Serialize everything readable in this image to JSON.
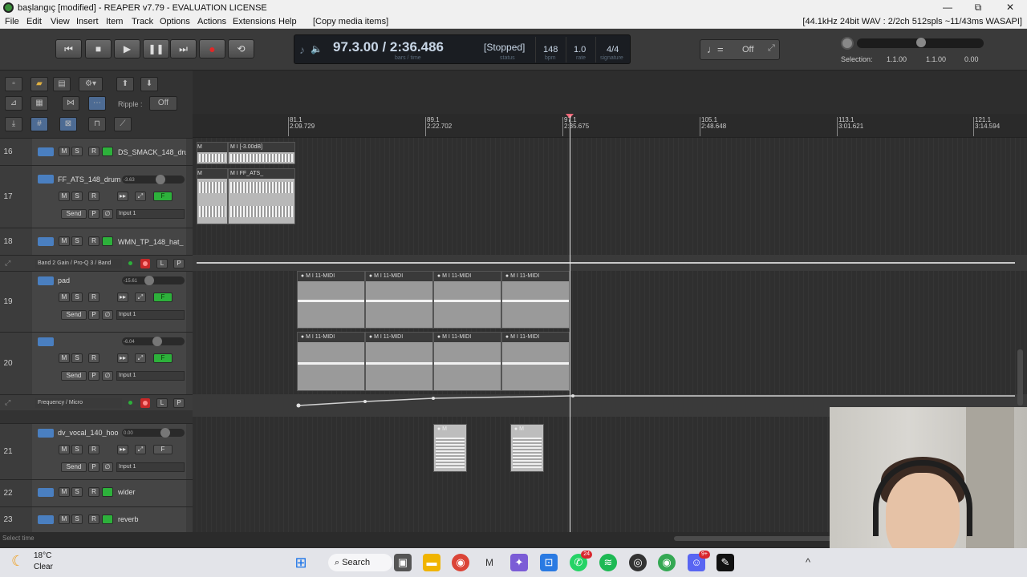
{
  "window": {
    "title": "başlangıç [modified] - REAPER v7.79 - EVALUATION LICENSE",
    "minimize": "—",
    "restore": "⧉",
    "close": "✕"
  },
  "menu": {
    "items": [
      "File",
      "Edit",
      "View",
      "Insert",
      "Item",
      "Track",
      "Options",
      "Actions",
      "Extensions",
      "Help",
      "[Copy media items]"
    ],
    "audio_status": "[44.1kHz 24bit WAV : 2/2ch 512spls ~11/43ms WASAPI]"
  },
  "transport": {
    "position": "97.3.00 / 2:36.486",
    "position_caption": "bars / time",
    "state": "[Stopped]",
    "state_caption": "status",
    "bpm": "148",
    "bpm_caption": "bpm",
    "rate": "1.0",
    "rate_caption": "rate",
    "signature": "4/4",
    "signature_caption": "signature",
    "metronome_state": "Off"
  },
  "selection": {
    "label": "Selection:",
    "start": "1.1.00",
    "end": "1.1.00",
    "length": "0.00"
  },
  "edit_tools": {
    "ripple_label": "Ripple :",
    "ripple_state": "Off"
  },
  "ruler": {
    "marks": [
      {
        "bar": "81.1",
        "time": "2:09.729"
      },
      {
        "bar": "89.1",
        "time": "2:22.702"
      },
      {
        "bar": "97.1",
        "time": "2:35.675"
      },
      {
        "bar": "105.1",
        "time": "2:48.648"
      },
      {
        "bar": "113.1",
        "time": "3:01.621"
      },
      {
        "bar": "121.1",
        "time": "3:14.594"
      }
    ]
  },
  "tracks": [
    {
      "num": "16",
      "name": "DS_SMACK_148_dru"
    },
    {
      "num": "17",
      "name": "FF_ATS_148_drum",
      "volume": "-3.63",
      "send": "Send",
      "input": "Input 1"
    },
    {
      "num": "18",
      "name": "WMN_TP_148_hat_"
    },
    {
      "num": "19",
      "name": "pad",
      "volume": "-15.61",
      "send": "Send",
      "input": "Input 1"
    },
    {
      "num": "20",
      "name": "",
      "volume": "-6.04",
      "send": "Send",
      "input": "Input 1"
    },
    {
      "num": "21",
      "name": "dv_vocal_140_hoo",
      "volume": "0.00",
      "send": "Send",
      "input": "Input 1"
    },
    {
      "num": "22",
      "name": "wider"
    },
    {
      "num": "23",
      "name": "reverb"
    }
  ],
  "envelopes": [
    {
      "name": "Band 2 Gain / Pro-Q 3 / Band"
    },
    {
      "name": "Frequency / Micro"
    }
  ],
  "buttons": {
    "mute": "M",
    "solo": "S",
    "recarm": "R",
    "fx": "F",
    "phase": "∅",
    "pan": "P",
    "env_read": "L"
  },
  "items": {
    "ds_smack": "[-3.00dB]",
    "ff_ats": "FF_ATS_",
    "midi_label": "11-MIDI",
    "mute_m": "M",
    "lock_i": "I"
  },
  "statusbar": {
    "text": "Select time"
  },
  "taskbar": {
    "temperature": "18°C",
    "condition": "Clear",
    "search": "Search",
    "whatsapp_badge": "24",
    "discord_badge": "9+"
  }
}
